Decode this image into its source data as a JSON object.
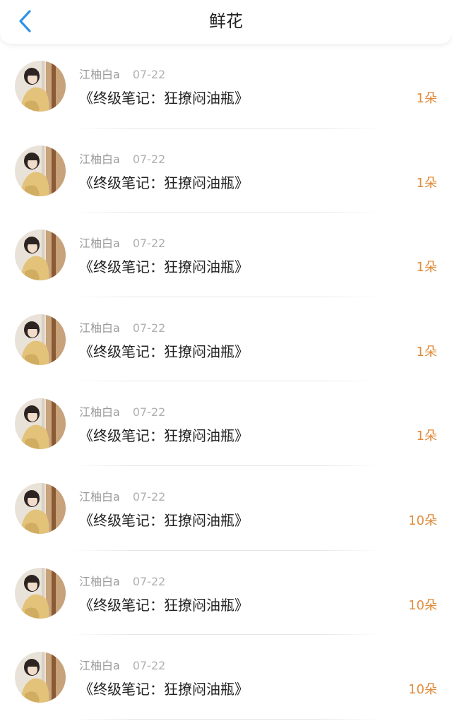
{
  "header": {
    "title": "鲜花",
    "back_icon": "chevron-left-icon",
    "back_color": "#2f93e6"
  },
  "colors": {
    "count": "#e08c3c",
    "meta": "#9a9a9a",
    "text": "#222222"
  },
  "items": [
    {
      "name": "江柚白a",
      "date": "07-22",
      "book": "《终级笔记：狂撩闷油瓶》",
      "count": "1朵"
    },
    {
      "name": "江柚白a",
      "date": "07-22",
      "book": "《终级笔记：狂撩闷油瓶》",
      "count": "1朵"
    },
    {
      "name": "江柚白a",
      "date": "07-22",
      "book": "《终级笔记：狂撩闷油瓶》",
      "count": "1朵"
    },
    {
      "name": "江柚白a",
      "date": "07-22",
      "book": "《终级笔记：狂撩闷油瓶》",
      "count": "1朵"
    },
    {
      "name": "江柚白a",
      "date": "07-22",
      "book": "《终级笔记：狂撩闷油瓶》",
      "count": "1朵"
    },
    {
      "name": "江柚白a",
      "date": "07-22",
      "book": "《终级笔记：狂撩闷油瓶》",
      "count": "10朵"
    },
    {
      "name": "江柚白a",
      "date": "07-22",
      "book": "《终级笔记：狂撩闷油瓶》",
      "count": "10朵"
    },
    {
      "name": "江柚白a",
      "date": "07-22",
      "book": "《终级笔记：狂撩闷油瓶》",
      "count": "10朵"
    }
  ]
}
